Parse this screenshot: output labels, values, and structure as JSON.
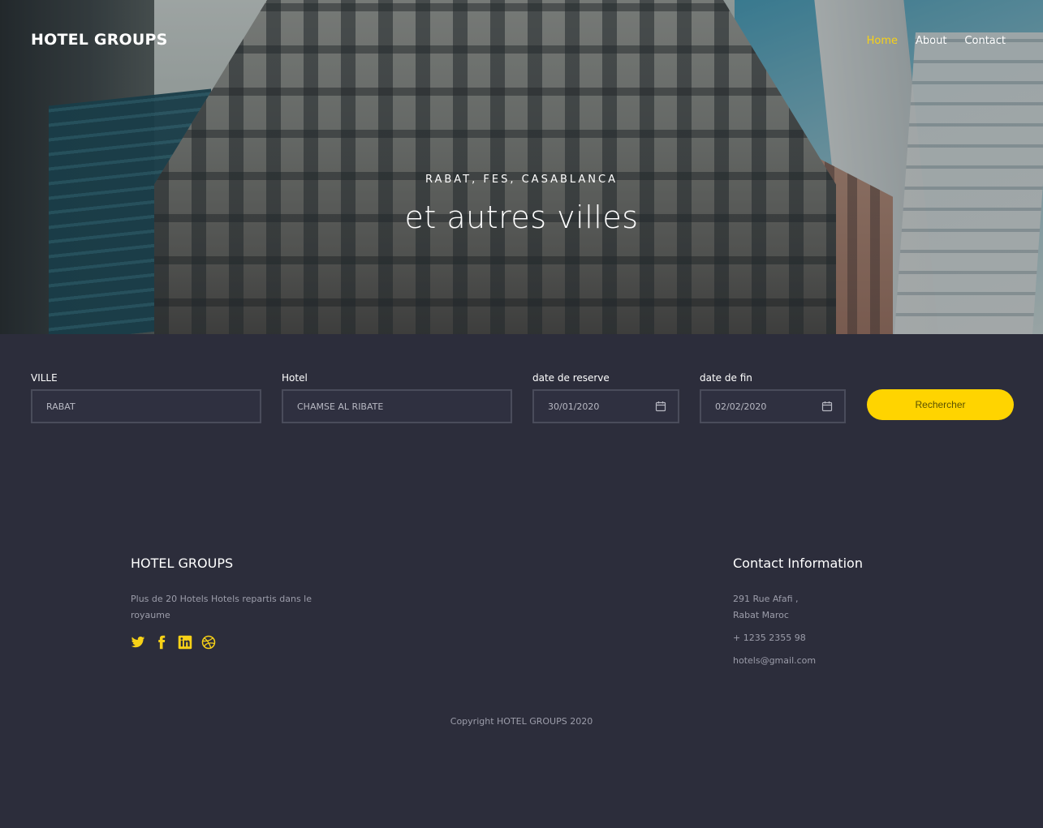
{
  "header": {
    "brand": "HOTEL GROUPS",
    "nav": [
      {
        "label": "Home",
        "active": true
      },
      {
        "label": "About",
        "active": false
      },
      {
        "label": "Contact",
        "active": false
      }
    ]
  },
  "hero": {
    "subtitle": "RABAT, FES, CASABLANCA",
    "title": "et autres villes"
  },
  "search": {
    "ville_label": "VILLE",
    "ville_value": "RABAT",
    "hotel_label": "Hotel",
    "hotel_value": "CHAMSE AL RIBATE",
    "start_label": "date de reserve",
    "start_value": "30/01/2020",
    "end_label": "date de fin",
    "end_value": "02/02/2020",
    "button_label": "Rechercher"
  },
  "footer": {
    "about_title": "HOTEL GROUPS",
    "about_text_line1": "Plus de 20 Hotels Hotels repartis dans le",
    "about_text_line2": "royaume",
    "social_icons": [
      "twitter-icon",
      "facebook-icon",
      "linkedin-icon",
      "dribbble-icon"
    ],
    "contact_title": "Contact Information",
    "address_line1": "291 Rue Afafi ,",
    "address_line2": "Rabat Maroc",
    "phone": "+ 1235 2355 98",
    "email": "hotels@gmail.com",
    "copyright": "Copyright HOTEL GROUPS 2020"
  },
  "colors": {
    "accent": "#ffd400",
    "background": "#2c2d3b"
  }
}
